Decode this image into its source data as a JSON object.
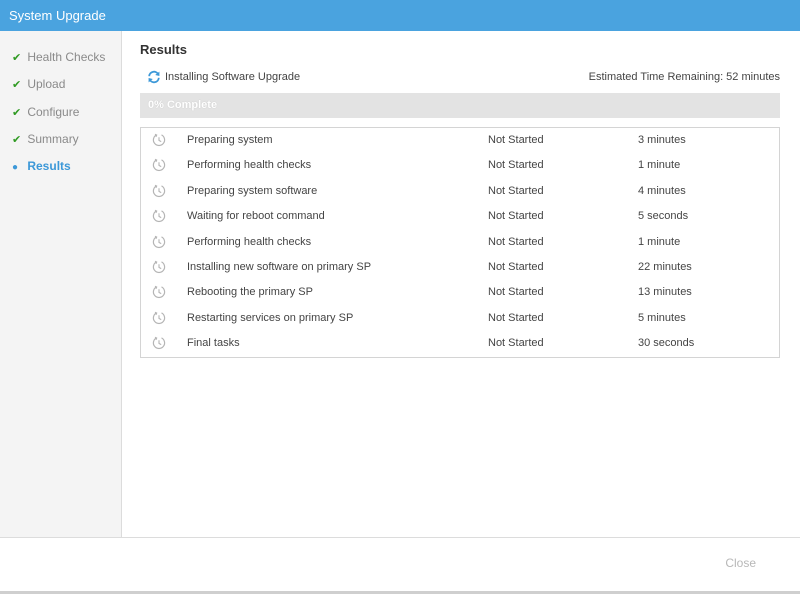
{
  "window": {
    "title": "System Upgrade"
  },
  "sidebar": {
    "steps": [
      {
        "label": "Health Checks",
        "state": "done",
        "icon": "check-icon"
      },
      {
        "label": "Upload",
        "state": "done",
        "icon": "check-icon"
      },
      {
        "label": "Configure",
        "state": "done",
        "icon": "check-icon"
      },
      {
        "label": "Summary",
        "state": "done",
        "icon": "check-icon"
      },
      {
        "label": "Results",
        "state": "active",
        "icon": "bullet-icon"
      }
    ]
  },
  "main": {
    "heading": "Results",
    "status_text": "Installing Software Upgrade",
    "status_icon": "refresh-icon",
    "eta": "Estimated Time Remaining: 52 minutes",
    "progress": {
      "label": "0% Complete",
      "percent": 0
    },
    "task_icon": "pending-clock-icon",
    "tasks": [
      {
        "name": "Preparing system",
        "status": "Not Started",
        "time": "3 minutes"
      },
      {
        "name": "Performing health checks",
        "status": "Not Started",
        "time": "1 minute"
      },
      {
        "name": "Preparing system software",
        "status": "Not Started",
        "time": "4 minutes"
      },
      {
        "name": "Waiting for reboot command",
        "status": "Not Started",
        "time": "5 seconds"
      },
      {
        "name": "Performing health checks",
        "status": "Not Started",
        "time": "1 minute"
      },
      {
        "name": "Installing new software on primary SP",
        "status": "Not Started",
        "time": "22 minutes"
      },
      {
        "name": "Rebooting the primary SP",
        "status": "Not Started",
        "time": "13 minutes"
      },
      {
        "name": "Restarting services on primary SP",
        "status": "Not Started",
        "time": "5 minutes"
      },
      {
        "name": "Final tasks",
        "status": "Not Started",
        "time": "30 seconds"
      }
    ]
  },
  "footer": {
    "close_label": "Close"
  },
  "colors": {
    "titlebar": "#4aa3df",
    "accent": "#3c98d8",
    "check": "#2f9a22",
    "disabled_text": "#b8b8b8"
  }
}
